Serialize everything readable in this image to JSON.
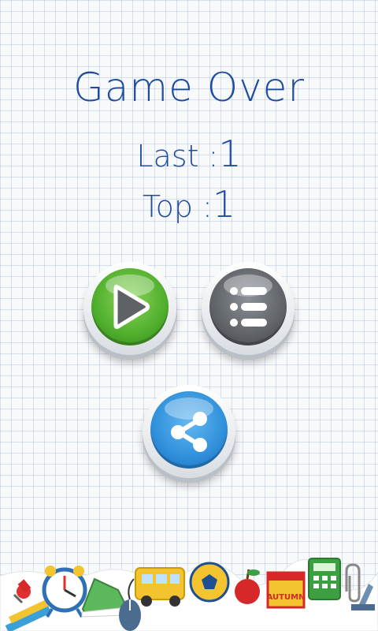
{
  "game_over": {
    "title": "Game Over",
    "last_label": "Last :",
    "last_value": "1",
    "top_label": "Top :",
    "top_value": "1"
  },
  "buttons": {
    "play_icon": "play-icon",
    "menu_icon": "list-menu-icon",
    "share_icon": "share-icon"
  },
  "footer": {
    "calendar_label": "AUTUMN"
  },
  "colors": {
    "text": "#1f4d9e",
    "play": "#4fae2c",
    "menu": "#5f6368",
    "share": "#2f8fdb"
  }
}
